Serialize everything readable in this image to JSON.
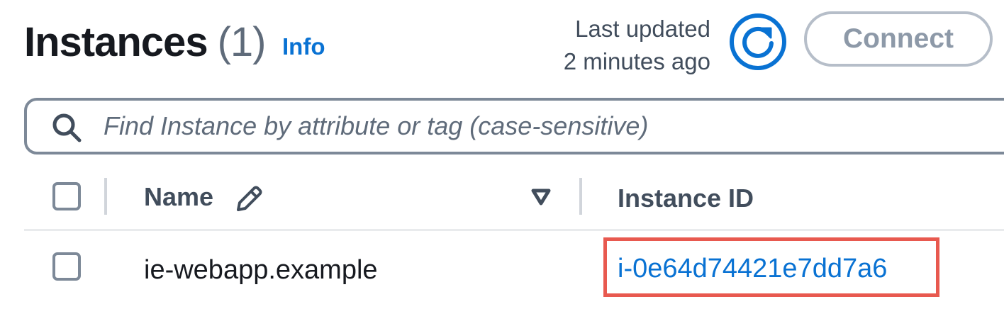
{
  "header": {
    "title": "Instances",
    "count": "(1)",
    "info_link": "Info",
    "last_updated_line1": "Last updated",
    "last_updated_line2": "2 minutes ago",
    "connect_label": "Connect"
  },
  "search": {
    "placeholder": "Find Instance by attribute or tag (case-sensitive)",
    "value": ""
  },
  "table": {
    "columns": [
      "Name",
      "Instance ID"
    ],
    "rows": [
      {
        "name": "ie-webapp.example",
        "instance_id": "i-0e64d74421e7dd7a6"
      }
    ]
  },
  "icons": {
    "refresh": "refresh-icon",
    "search": "search-icon",
    "edit": "pencil-icon",
    "sort": "caret-down-icon"
  },
  "colors": {
    "link": "#0972d3",
    "highlight": "#e8594f",
    "border": "#7d8998",
    "disabled_text": "#8d99a8"
  }
}
